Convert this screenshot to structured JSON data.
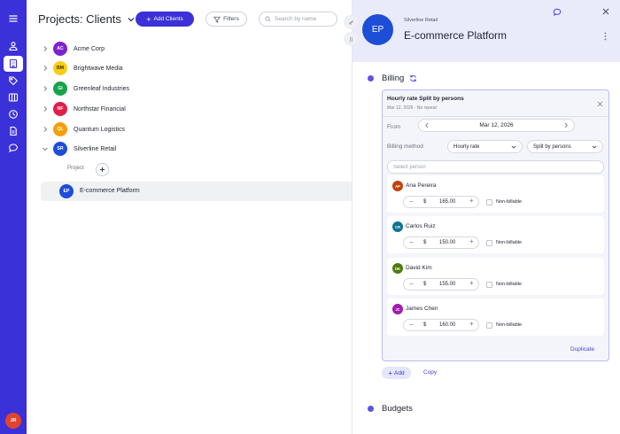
{
  "rail": {
    "items": [
      "users-icon",
      "building-icon",
      "tag-icon",
      "table-icon",
      "clock-icon",
      "document-icon",
      "chat-icon"
    ],
    "active_index": 1,
    "user_initials": "JR"
  },
  "header": {
    "title": "Projects: Clients",
    "add_clients_label": "Add Clients",
    "filters_label": "Filters",
    "search_placeholder": "Search by name"
  },
  "clients": [
    {
      "initials": "AC",
      "name": "Acme Corp",
      "color": "#7e22ce",
      "expanded": false
    },
    {
      "initials": "BM",
      "name": "Brightwave Media",
      "color": "#facc15",
      "expanded": false
    },
    {
      "initials": "GI",
      "name": "Greenleaf Industries",
      "color": "#16a34a",
      "expanded": false
    },
    {
      "initials": "NF",
      "name": "Northstar Financial",
      "color": "#e11d48",
      "expanded": false
    },
    {
      "initials": "QL",
      "name": "Quantum Logistics",
      "color": "#f59e0b",
      "expanded": false
    },
    {
      "initials": "SR",
      "name": "Silverline Retail",
      "color": "#1d4ed8",
      "expanded": true
    }
  ],
  "project_section": {
    "label": "Project",
    "projects": [
      {
        "initials": "EP",
        "name": "E-commerce Platform"
      }
    ]
  },
  "panel": {
    "client_name": "Silverline Retail",
    "project_title": "E-commerce Platform",
    "project_initials": "EP",
    "billing": {
      "title": "Billing",
      "card_title": "Hourly rate Split by persons",
      "card_subtitle": "Mar 12, 2026 · No repeat",
      "from_label": "From",
      "from_date": "Mar 12, 2026",
      "method_label": "Billing method",
      "method_value": "Hourly rate",
      "split_value": "Split by persons",
      "select_person_placeholder": "Select person",
      "currency": "$",
      "non_billable_label": "Non-billable",
      "persons": [
        {
          "initials": "AP",
          "name": "Ana Pereira",
          "rate": "165.00",
          "color": "#c2410c",
          "non_billable": false
        },
        {
          "initials": "CR",
          "name": "Carlos Ruiz",
          "rate": "150.00",
          "color": "#0e7490",
          "non_billable": false
        },
        {
          "initials": "DK",
          "name": "David Kim",
          "rate": "155.00",
          "color": "#4d7c0f",
          "non_billable": false
        },
        {
          "initials": "JC",
          "name": "James Chen",
          "rate": "160.00",
          "color": "#a21caf",
          "non_billable": false
        }
      ],
      "duplicate_label": "Duplicate",
      "add_label": "Add",
      "copy_label": "Copy"
    },
    "budgets_title": "Budgets"
  }
}
